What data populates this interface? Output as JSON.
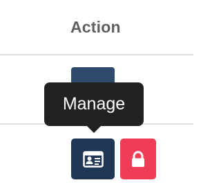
{
  "table": {
    "header": {
      "action_label": "Action"
    }
  },
  "row": {
    "actions": {
      "manage": {
        "tooltip": "Manage",
        "icon": "id-card-icon",
        "color": "#1f3654"
      },
      "lock": {
        "icon": "lock-icon",
        "color": "#ef3d57"
      }
    }
  },
  "colors": {
    "header_text": "#5f5f5f",
    "divider": "#dedede",
    "tooltip_bg": "#222222"
  }
}
